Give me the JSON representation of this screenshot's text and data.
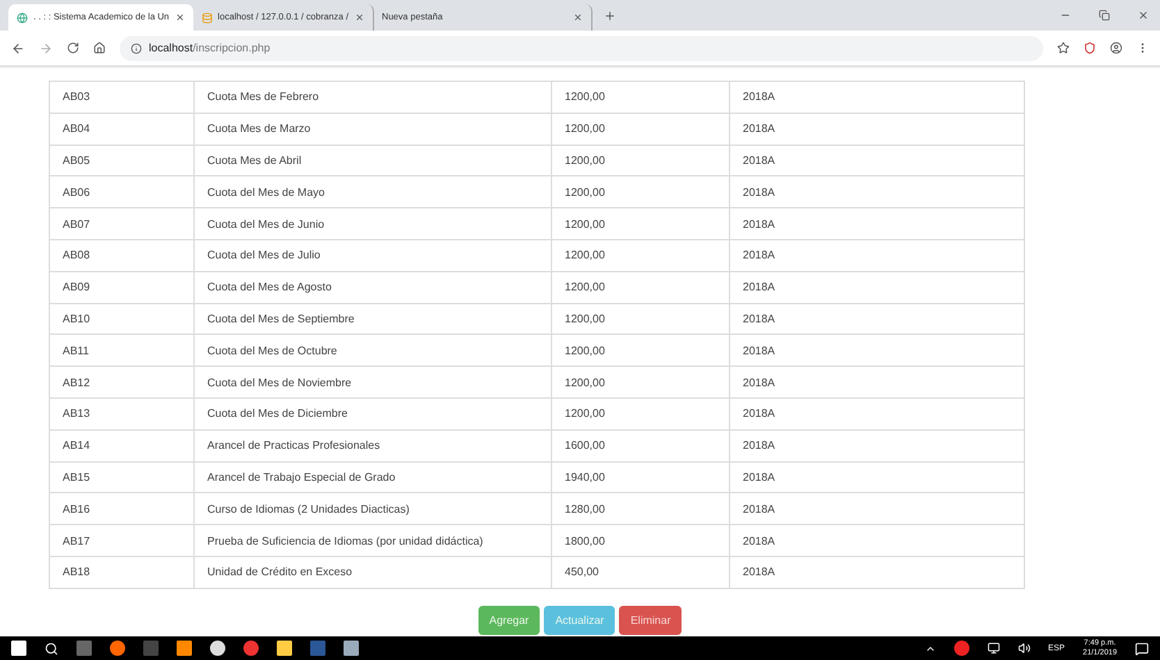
{
  "browser": {
    "tabs": [
      {
        "title": ". . : : Sistema Academico de la Un",
        "selected": true,
        "kind": "site"
      },
      {
        "title": "localhost / 127.0.0.1 / cobranza /",
        "selected": false,
        "kind": "db"
      },
      {
        "title": "Nueva pestaña",
        "selected": false,
        "kind": "blank"
      }
    ],
    "address": {
      "host": "localhost",
      "path": "/inscripcion.php"
    }
  },
  "table": {
    "rows": [
      {
        "code": "AB03",
        "concept": "Cuota Mes de Febrero",
        "amount": "1200,00",
        "period": "2018A"
      },
      {
        "code": "AB04",
        "concept": "Cuota Mes de Marzo",
        "amount": "1200,00",
        "period": "2018A"
      },
      {
        "code": "AB05",
        "concept": "Cuota Mes de Abril",
        "amount": "1200,00",
        "period": "2018A"
      },
      {
        "code": "AB06",
        "concept": "Cuota del Mes de Mayo",
        "amount": "1200,00",
        "period": "2018A"
      },
      {
        "code": "AB07",
        "concept": "Cuota del Mes de Junio",
        "amount": "1200,00",
        "period": "2018A"
      },
      {
        "code": "AB08",
        "concept": "Cuota del Mes de Julio",
        "amount": "1200,00",
        "period": "2018A"
      },
      {
        "code": "AB09",
        "concept": "Cuota del Mes de Agosto",
        "amount": "1200,00",
        "period": "2018A"
      },
      {
        "code": "AB10",
        "concept": "Cuota del Mes de Septiembre",
        "amount": "1200,00",
        "period": "2018A"
      },
      {
        "code": "AB11",
        "concept": "Cuota del Mes de Octubre",
        "amount": "1200,00",
        "period": "2018A"
      },
      {
        "code": "AB12",
        "concept": "Cuota del Mes de Noviembre",
        "amount": "1200,00",
        "period": "2018A"
      },
      {
        "code": "AB13",
        "concept": "Cuota del Mes de Diciembre",
        "amount": "1200,00",
        "period": "2018A"
      },
      {
        "code": "AB14",
        "concept": "Arancel de Practicas Profesionales",
        "amount": "1600,00",
        "period": "2018A"
      },
      {
        "code": "AB15",
        "concept": "Arancel de Trabajo Especial de Grado",
        "amount": "1940,00",
        "period": "2018A"
      },
      {
        "code": "AB16",
        "concept": "Curso de Idiomas (2 Unidades Diacticas)",
        "amount": "1280,00",
        "period": "2018A"
      },
      {
        "code": "AB17",
        "concept": "Prueba de Suficiencia de Idiomas (por unidad didáctica)",
        "amount": "1800,00",
        "period": "2018A"
      },
      {
        "code": "AB18",
        "concept": "Unidad de Crédito en Exceso",
        "amount": "450,00",
        "period": "2018A"
      }
    ]
  },
  "buttons": [
    {
      "label": "Agregar",
      "kind": "success"
    },
    {
      "label": "Actualizar",
      "kind": "info"
    },
    {
      "label": "Eliminar",
      "kind": "danger"
    }
  ],
  "taskbar": {
    "language": "ESP",
    "time": "7:49 p.m.",
    "date": "21/1/2019"
  }
}
